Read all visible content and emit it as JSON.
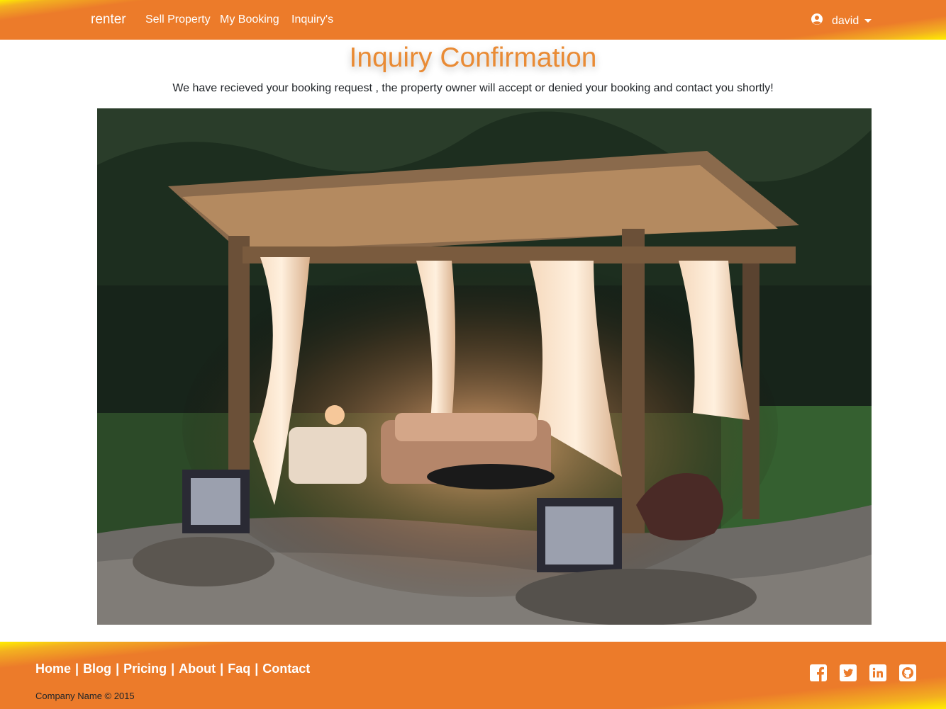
{
  "navbar": {
    "brand": "renter",
    "links": [
      "Sell Property",
      "My Booking",
      "Inquiry's"
    ],
    "user": "david"
  },
  "main": {
    "title": "Inquiry Confirmation",
    "message": "We have recieved your booking request , the property owner will accept or denied your booking and contact you shortly!"
  },
  "footer": {
    "links": [
      "Home",
      "Blog",
      "Pricing",
      "About",
      "Faq",
      "Contact"
    ],
    "separator": "|",
    "copyright": "Company Name © 2015",
    "socials": [
      "facebook-icon",
      "twitter-icon",
      "linkedin-icon",
      "github-icon"
    ]
  },
  "colors": {
    "accent": "#ec7b2a",
    "highlight": "#ffee00",
    "title": "#e98b35"
  }
}
